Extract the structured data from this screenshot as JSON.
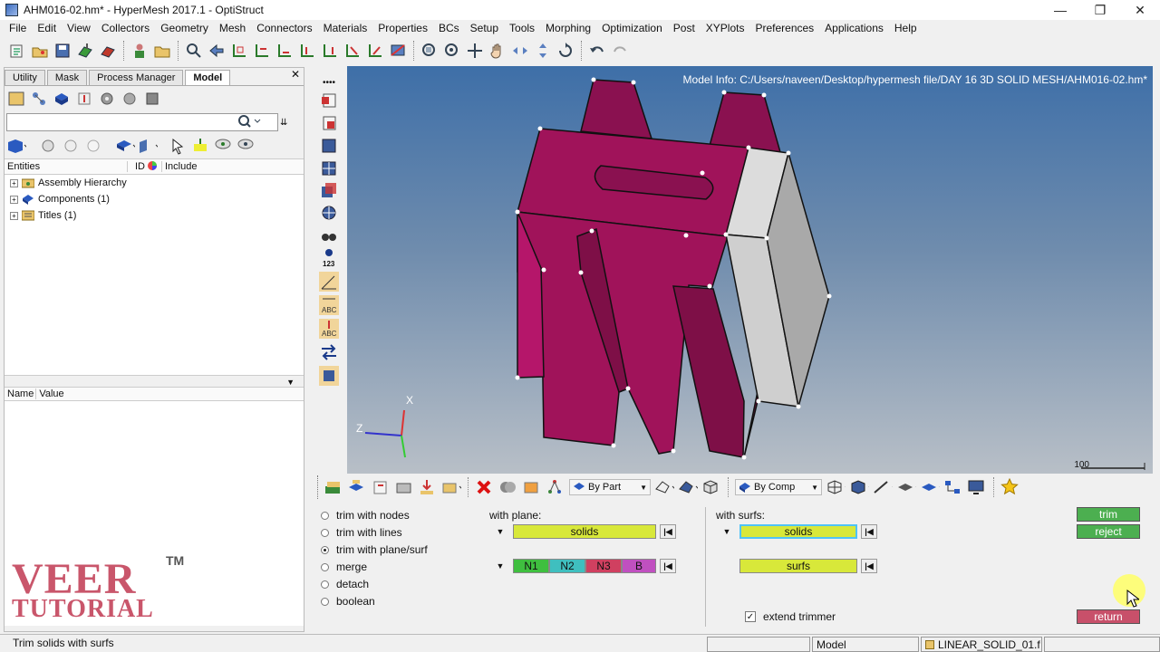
{
  "window": {
    "title": "AHM016-02.hm* - HyperMesh 2017.1 - OptiStruct",
    "controls": [
      "minimize-icon",
      "restore-icon",
      "close-icon"
    ]
  },
  "menu": [
    "File",
    "Edit",
    "View",
    "Collectors",
    "Geometry",
    "Mesh",
    "Connectors",
    "Materials",
    "Properties",
    "BCs",
    "Setup",
    "Tools",
    "Morphing",
    "Optimization",
    "Post",
    "XYPlots",
    "Preferences",
    "Applications",
    "Help"
  ],
  "browser": {
    "tabs": [
      "Utility",
      "Mask",
      "Process Manager",
      "Model"
    ],
    "active_tab": "Model",
    "columns": {
      "entities": "Entities",
      "id": "ID",
      "include": "Include"
    },
    "tree": [
      {
        "label": "Assembly Hierarchy",
        "icon": "assembly-icon"
      },
      {
        "label": "Components (1)",
        "icon": "component-icon"
      },
      {
        "label": "Titles (1)",
        "icon": "titles-icon"
      }
    ],
    "nv_columns": {
      "name": "Name",
      "value": "Value"
    }
  },
  "logo": {
    "line1": "VEER",
    "line2": "TUTORIAL",
    "tm": "TM"
  },
  "graphics": {
    "model_info": "Model Info: C:/Users/naveen/Desktop/hypermesh file/DAY 16 3D SOLID MESH/AHM016-02.hm*",
    "scale_label": "100",
    "triad": {
      "x": "X",
      "z": "Z"
    },
    "colors": {
      "part": "#a0135a",
      "cut_face": "#d2d2d2",
      "bg_top": "#3e6fa8",
      "bg_bottom": "#b8bfc7"
    }
  },
  "bottom_toolbar": {
    "by_part": "By Part",
    "by_comp": "By Comp"
  },
  "panel": {
    "options": [
      {
        "label": "trim with nodes",
        "selected": false
      },
      {
        "label": "trim with lines",
        "selected": false
      },
      {
        "label": "trim with plane/surf",
        "selected": true
      },
      {
        "label": "merge",
        "selected": false
      },
      {
        "label": "detach",
        "selected": false
      },
      {
        "label": "boolean",
        "selected": false
      }
    ],
    "with_plane": "with plane:",
    "plane_solids": "solids",
    "plane_nodes": [
      "N1",
      "N2",
      "N3",
      "B"
    ],
    "with_surfs": "with surfs:",
    "surfs_solids": "solids",
    "surfs": "surfs",
    "extend_trimmer": "extend trimmer",
    "extend_trimmer_checked": true,
    "trim": "trim",
    "reject": "reject",
    "return": "return",
    "colors": {
      "selector": "#d8e83a",
      "green": "#4caf50",
      "return": "#c8506a",
      "n1": "#3fbf3f",
      "n2": "#3fbfbf",
      "n3": "#d04060",
      "b": "#c050c0"
    }
  },
  "status": {
    "message": "Trim solids with surfs",
    "model": "Model",
    "component": "LINEAR_SOLID_01.f"
  }
}
